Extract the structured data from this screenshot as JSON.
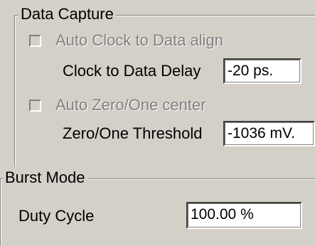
{
  "data_capture": {
    "title": "Data Capture",
    "auto_clock_checkbox_label": "Auto Clock to Data align",
    "auto_clock_checked": false,
    "clock_delay_label": "Clock to Data Delay",
    "clock_delay_value": "-20 ps.",
    "auto_zero_checkbox_label": "Auto Zero/One center",
    "auto_zero_checked": false,
    "threshold_label": "Zero/One Threshold",
    "threshold_value": "-1036 mV."
  },
  "burst_mode": {
    "title": "Burst Mode",
    "duty_cycle_label": "Duty Cycle",
    "duty_cycle_value": "100.00 %"
  }
}
